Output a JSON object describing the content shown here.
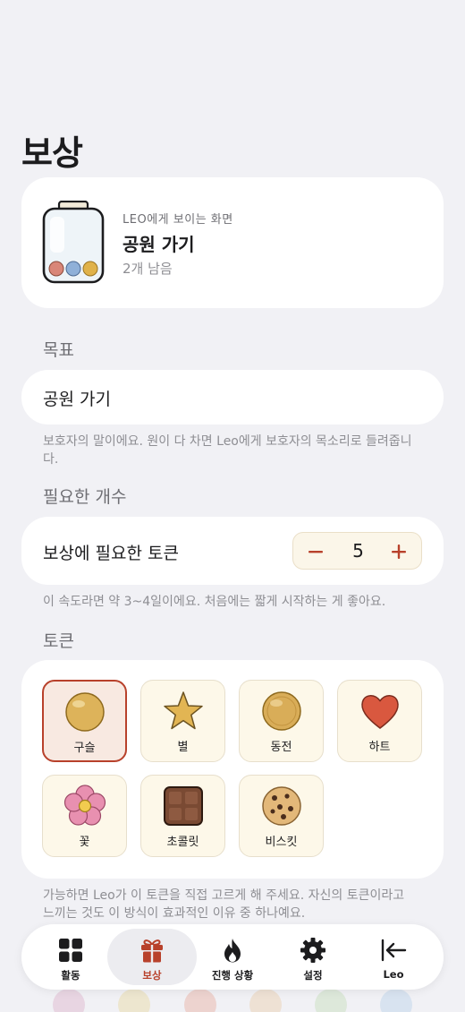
{
  "page": {
    "title": "보상"
  },
  "preview": {
    "subtitle": "LEO에게 보이는 화면",
    "title": "공원 가기",
    "remaining": "2개 남음"
  },
  "goal": {
    "header": "목표",
    "value": "공원 가기",
    "note": "보호자의 말이에요. 원이 다 차면 Leo에게 보호자의 목소리로 들려줍니다."
  },
  "count": {
    "header": "필요한 개수",
    "label": "보상에 필요한 토큰",
    "value": "5",
    "note": "이 속도라면 약 3~4일이에요. 처음에는 짧게 시작하는 게 좋아요."
  },
  "tokens": {
    "header": "토큰",
    "items": [
      {
        "label": "구슬",
        "icon": "marble-icon",
        "selected": true
      },
      {
        "label": "별",
        "icon": "star-icon",
        "selected": false
      },
      {
        "label": "동전",
        "icon": "coin-icon",
        "selected": false
      },
      {
        "label": "하트",
        "icon": "heart-icon",
        "selected": false
      },
      {
        "label": "꽃",
        "icon": "flower-icon",
        "selected": false
      },
      {
        "label": "초콜릿",
        "icon": "chocolate-icon",
        "selected": false
      },
      {
        "label": "비스킷",
        "icon": "biscuit-icon",
        "selected": false
      }
    ],
    "note": "가능하면 Leo가 이 토큰을 직접 고르게 해 주세요. 자신의 토큰이라고 느끼는 것도 이 방식이 효과적인 이유 중 하나예요."
  },
  "tabbar": {
    "tabs": [
      {
        "label": "활동",
        "icon": "grid-icon",
        "active": false
      },
      {
        "label": "보상",
        "icon": "gift-icon",
        "active": true
      },
      {
        "label": "진행 상황",
        "icon": "flame-icon",
        "active": false
      },
      {
        "label": "설정",
        "icon": "gear-icon",
        "active": false
      },
      {
        "label": "Leo",
        "icon": "arrow-left-icon",
        "active": false
      }
    ]
  },
  "colors": {
    "accent": "#b8412b",
    "background": "#f1f1f5",
    "card": "#ffffff",
    "token_bg": "#fdf8e9"
  }
}
